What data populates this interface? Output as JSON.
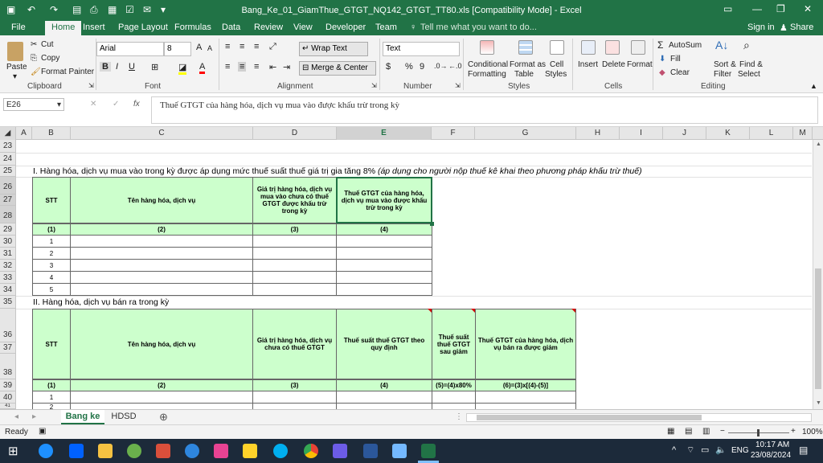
{
  "titlebar": {
    "title": "Bang_Ke_01_GiamThue_GTGT_NQ142_GTGT_TT80.xls  [Compatibility Mode] - Excel",
    "signin": "Sign in",
    "share": "Share",
    "tell_me": "Tell me what you want to do..."
  },
  "tabs": [
    "File",
    "Home",
    "Insert",
    "Page Layout",
    "Formulas",
    "Data",
    "Review",
    "View",
    "Developer",
    "Team"
  ],
  "ribbon": {
    "clipboard": {
      "paste": "Paste",
      "cut": "Cut",
      "copy": "Copy",
      "format_painter": "Format Painter",
      "label": "Clipboard"
    },
    "font": {
      "name": "Arial",
      "size": "8",
      "bold": "B",
      "italic": "I",
      "underline": "U",
      "label": "Font"
    },
    "alignment": {
      "wrap": "Wrap Text",
      "merge": "Merge & Center",
      "label": "Alignment"
    },
    "number": {
      "format": "Text",
      "currency": "$",
      "percent": "%",
      "comma": "9",
      "label": "Number"
    },
    "styles": {
      "conditional": "Conditional",
      "conditional2": "Formatting",
      "format_as": "Format as",
      "format_as2": "Table",
      "cell": "Cell",
      "cell2": "Styles",
      "label": "Styles"
    },
    "cells": {
      "insert": "Insert",
      "delete": "Delete",
      "format": "Format",
      "label": "Cells"
    },
    "editing": {
      "autosum": "AutoSum",
      "fill": "Fill",
      "clear": "Clear",
      "sort": "Sort &",
      "sort2": "Filter",
      "find": "Find &",
      "find2": "Select",
      "label": "Editing"
    }
  },
  "formula_bar": {
    "name_box": "E26",
    "fx": "fx",
    "content": "Thuế GTGT của hàng hóa, dịch vụ mua vào được khấu trừ trong kỳ"
  },
  "columns": [
    "A",
    "B",
    "C",
    "D",
    "E",
    "F",
    "G",
    "H",
    "I",
    "J",
    "K",
    "L",
    "M"
  ],
  "rows": [
    "23",
    "24",
    "25",
    "26",
    "27",
    "28",
    "29",
    "30",
    "31",
    "32",
    "33",
    "34",
    "35",
    "36",
    "37",
    "38",
    "39",
    "40",
    "41"
  ],
  "section1": {
    "title": "I. Hàng hóa, dịch vụ mua vào trong kỳ được áp dụng mức thuế suất thuế giá trị gia tăng 8%",
    "note": "(áp dụng cho người nộp thuế kê khai theo phương pháp khấu trừ thuế)",
    "headers": [
      "STT",
      "Tên hàng hóa, dịch vụ",
      "Giá trị hàng hóa, dịch vụ mua vào chưa có thuế GTGT được khấu trừ trong kỳ",
      "Thuế GTGT của hàng hóa, dịch vụ mua vào được khấu trừ trong kỳ"
    ],
    "codes": [
      "(1)",
      "(2)",
      "(3)",
      "(4)"
    ],
    "stt": [
      "1",
      "2",
      "3",
      "4",
      "5"
    ]
  },
  "section2": {
    "title": "II. Hàng hóa, dịch vụ bán ra trong kỳ",
    "headers": [
      "STT",
      "Tên hàng hóa, dịch vụ",
      "Giá trị hàng hóa, dịch vụ chưa có thuế GTGT",
      "Thuế suất thuế GTGT theo quy định",
      "Thuế suất thuế GTGT sau giảm",
      "Thuế GTGT của hàng hóa, dịch vụ bán ra được giảm"
    ],
    "codes": [
      "(1)",
      "(2)",
      "(3)",
      "(4)",
      "(5)=(4)x80%",
      "(6)=(3)x[(4)-(5)]"
    ],
    "stt": [
      "1",
      "2"
    ]
  },
  "sheets": [
    "Bang ke",
    "HDSD"
  ],
  "status": {
    "ready": "Ready",
    "zoom": "100%"
  },
  "taskbar": {
    "lang": "ENG",
    "time": "10:17 AM",
    "date": "23/08/2024"
  },
  "colors": {
    "excel_green": "#217346",
    "header_fill": "#ccffcc"
  }
}
